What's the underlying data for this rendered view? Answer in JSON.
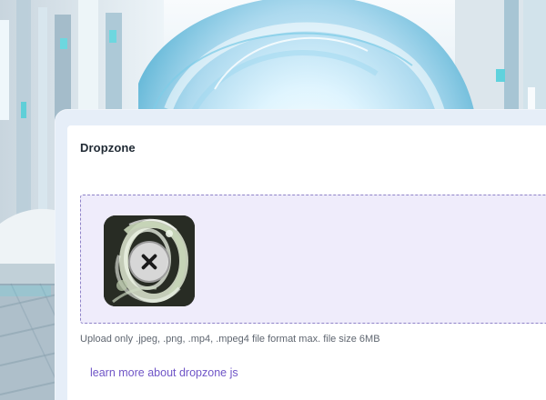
{
  "theme": {
    "panel_bg": "#e6eef8",
    "card_bg": "#ffffff",
    "dropzone_bg": "#efecfb",
    "dropzone_border": "#8f83c8",
    "link_color": "#6f55c7",
    "text_color": "#1f2933",
    "muted_text": "#5f6670"
  },
  "card": {
    "title": "Dropzone"
  },
  "dropzone": {
    "preview_icon": "image-thumbnail",
    "remove_icon": "close-icon",
    "help_text": "Upload only .jpeg, .png, .mp4, .mpeg4 file format max. file size 6MB"
  },
  "footer": {
    "link_label": "learn more about dropzone js"
  }
}
